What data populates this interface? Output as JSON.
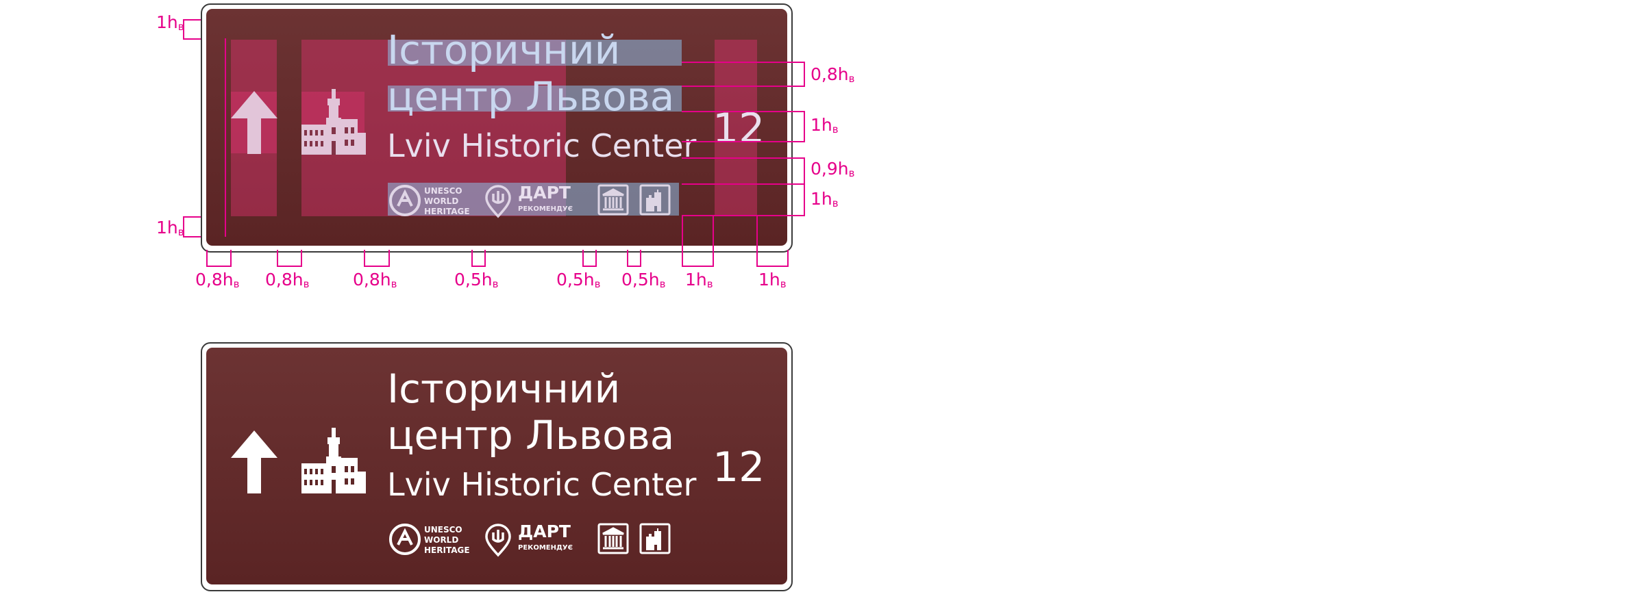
{
  "colors": {
    "sign_background": "#5e2828",
    "sign_text": "#ffffff",
    "dimension_accent": "#e6008a",
    "guide_fill": "#c8335f",
    "text_guide_fill": "#8cbee6"
  },
  "sign": {
    "title_line1": "Історичний",
    "title_line2": "центр Львова",
    "subtitle": "Lviv Historic Center",
    "distance": "12",
    "direction_icon": "arrow-up-icon",
    "landmark_icon": "town-hall-icon",
    "badges": {
      "unesco_line1": "UNESCO",
      "unesco_line2": "WORLD",
      "unesco_line3": "HERITAGE",
      "dart_title": "ДАРТ",
      "dart_sub": "РЕКОМЕНДУЄ",
      "museum_icon": "museum-icon",
      "castle_icon": "castle-icon"
    }
  },
  "dimensions": {
    "top_margin": "1h",
    "bottom_margin": "1h",
    "line_gap": "0,8h",
    "title_height": "1h",
    "subtitle_gap": "0,9h",
    "badge_height": "1h",
    "left_margin": "0,8h",
    "arrow_gap": "0,8h",
    "icon_gap": "0,8h",
    "badge_gap_1": "0,5h",
    "badge_gap_2": "0,5h",
    "badge_gap_3": "0,5h",
    "number_gap": "1h",
    "right_margin": "1h",
    "unit_subscript": "в"
  }
}
